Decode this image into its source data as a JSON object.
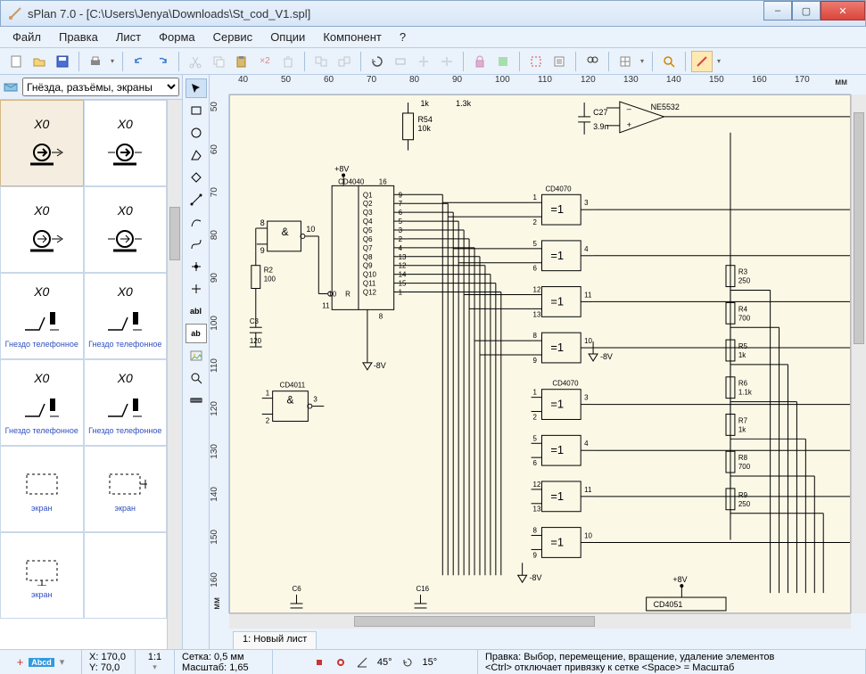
{
  "window": {
    "title": "sPlan 7.0 - [C:\\Users\\Jenya\\Downloads\\St_cod_V1.spl]"
  },
  "menu": [
    "Файл",
    "Правка",
    "Лист",
    "Форма",
    "Сервис",
    "Опции",
    "Компонент",
    "?"
  ],
  "library": {
    "category": "Гнёзда, разъёмы, экраны",
    "cells": [
      {
        "label": "X0",
        "sub": "",
        "selected": true
      },
      {
        "label": "X0",
        "sub": ""
      },
      {
        "label": "X0",
        "sub": ""
      },
      {
        "label": "X0",
        "sub": ""
      },
      {
        "label": "X0",
        "sub": "Гнездо телефонное"
      },
      {
        "label": "X0",
        "sub": "Гнездо телефонное"
      },
      {
        "label": "X0",
        "sub": "Гнездо телефонное"
      },
      {
        "label": "X0",
        "sub": "Гнездо телефонное"
      },
      {
        "label": "",
        "sub": "экран"
      },
      {
        "label": "",
        "sub": "экран"
      },
      {
        "label": "",
        "sub": "экран"
      },
      {
        "label": "",
        "sub": ""
      }
    ]
  },
  "hruler": {
    "start": 40,
    "step": 10,
    "count": 14,
    "unit": "мм"
  },
  "vruler": {
    "start": 50,
    "step": 10,
    "count": 12,
    "unit": "мм"
  },
  "tab": {
    "label": "1: Новый лист"
  },
  "status": {
    "pos_x": "X: 170,0",
    "pos_y": "Y: 70,0",
    "ratio": "1:1",
    "grid_label": "Сетка:",
    "grid_val": "0,5 мм",
    "scale_label": "Масштаб:",
    "scale_val": "1,65",
    "angle1": "45°",
    "angle2": "15°",
    "hint1": "Правка: Выбор, перемещение, вращение, удаление элементов",
    "hint2": "<Ctrl> отключает привязку к сетке  <Space> = Масштаб"
  },
  "schematic": {
    "top_labels": {
      "r_left": "1k",
      "r_right": "1.3k",
      "cap": "C27",
      "cap_val": "3.9n",
      "opamp": "NE5532",
      "r54": "R54",
      "r54_val": "10k"
    },
    "rails": {
      "p8v": "+8V",
      "n8v": "-8V"
    },
    "cd4040": {
      "name": "CD4040",
      "pin16": "16",
      "pin11": "11",
      "pin8": "8",
      "q": [
        "Q1",
        "Q2",
        "Q3",
        "Q4",
        "Q5",
        "Q6",
        "Q7",
        "Q8",
        "Q9",
        "Q10",
        "Q11",
        "Q12"
      ],
      "qn": [
        "9",
        "7",
        "6",
        "5",
        "3",
        "2",
        "4",
        "13",
        "12",
        "14",
        "15",
        "1"
      ],
      "left": [
        "10",
        "11"
      ],
      "R": "R"
    },
    "gate_left": {
      "top8": "8",
      "top9": "9",
      "out10": "10",
      "sym": "&"
    },
    "cd4011": {
      "name": "CD4011",
      "p1": "1",
      "p2": "2",
      "p3": "3",
      "sym": "&"
    },
    "r2": {
      "name": "R2",
      "val": "100"
    },
    "c3": {
      "name": "C3",
      "val": "120"
    },
    "cd4070": {
      "name": "CD4070",
      "sym": "=1",
      "blocks": [
        {
          "a": "1",
          "b": "2",
          "o": "3"
        },
        {
          "a": "5",
          "b": "6",
          "o": "4"
        },
        {
          "a": "12",
          "b": "13",
          "o": "11"
        },
        {
          "a": "8",
          "b": "9",
          "o": "10"
        },
        {
          "a": "1",
          "b": "2",
          "o": "3"
        },
        {
          "a": "5",
          "b": "6",
          "o": "4"
        },
        {
          "a": "12",
          "b": "13",
          "o": "11"
        },
        {
          "a": "8",
          "b": "9",
          "o": "10"
        }
      ]
    },
    "resistors_right": [
      {
        "n": "R3",
        "v": "250"
      },
      {
        "n": "R4",
        "v": "700"
      },
      {
        "n": "R5",
        "v": "1k"
      },
      {
        "n": "R6",
        "v": "1.1k"
      },
      {
        "n": "R7",
        "v": "1k"
      },
      {
        "n": "R8",
        "v": "700"
      },
      {
        "n": "R9",
        "v": "250"
      }
    ],
    "caps_bottom": [
      "C6",
      "C16"
    ],
    "cd4051": "CD4051"
  }
}
